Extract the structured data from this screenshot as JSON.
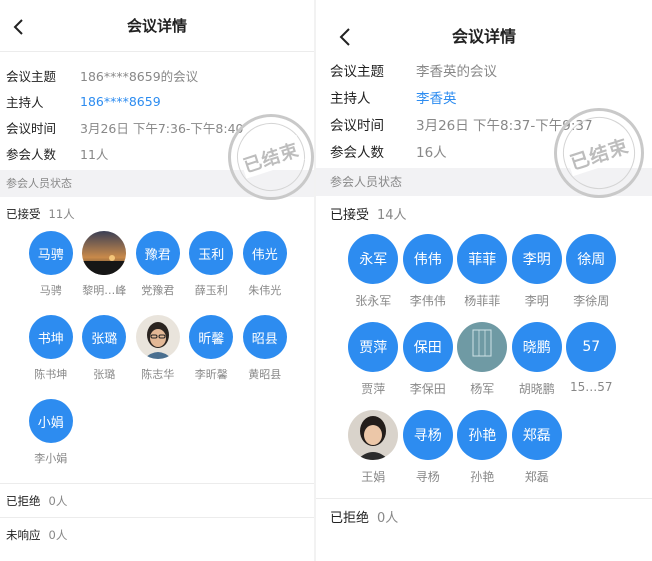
{
  "left": {
    "nav_title": "会议详情",
    "stamp_text": "已结束",
    "info": [
      {
        "label": "会议主题",
        "value": "186****8659的会议"
      },
      {
        "label": "主持人",
        "value": "186****8659"
      },
      {
        "label": "会议时间",
        "value": "3月26日 下午7:36-下午8:40"
      },
      {
        "label": "参会人数",
        "value": "11人"
      }
    ],
    "section_label": "参会人员状态",
    "accepted": {
      "label": "已接受",
      "count": "11人"
    },
    "participants": [
      {
        "avatar": "马骋",
        "name": "马骋"
      },
      {
        "avatar": "",
        "name": "黎明…峰"
      },
      {
        "avatar": "豫君",
        "name": "党豫君"
      },
      {
        "avatar": "玉利",
        "name": "薛玉利"
      },
      {
        "avatar": "伟光",
        "name": "朱伟光"
      },
      {
        "avatar": "书坤",
        "name": "陈书坤"
      },
      {
        "avatar": "张璐",
        "name": "张璐"
      },
      {
        "avatar": "",
        "name": "陈志华"
      },
      {
        "avatar": "昕馨",
        "name": "李昕馨"
      },
      {
        "avatar": "昭县",
        "name": "黄昭县"
      },
      {
        "avatar": "小娟",
        "name": "李小娟"
      }
    ],
    "rejected": {
      "label": "已拒绝",
      "count": "0人"
    },
    "no_response": {
      "label": "未响应",
      "count": "0人"
    }
  },
  "right": {
    "nav_title": "会议详情",
    "stamp_text": "已结束",
    "info": [
      {
        "label": "会议主题",
        "value": "李香英的会议"
      },
      {
        "label": "主持人",
        "value": "李香英"
      },
      {
        "label": "会议时间",
        "value": "3月26日 下午8:37-下午9:37"
      },
      {
        "label": "参会人数",
        "value": "16人"
      }
    ],
    "section_label": "参会人员状态",
    "accepted": {
      "label": "已接受",
      "count": "14人"
    },
    "participants": [
      {
        "avatar": "永军",
        "name": "张永军"
      },
      {
        "avatar": "伟伟",
        "name": "李伟伟"
      },
      {
        "avatar": "菲菲",
        "name": "杨菲菲"
      },
      {
        "avatar": "李明",
        "name": "李明"
      },
      {
        "avatar": "徐周",
        "name": "李徐周"
      },
      {
        "avatar": "贾萍",
        "name": "贾萍"
      },
      {
        "avatar": "保田",
        "name": "李保田"
      },
      {
        "avatar": "",
        "name": "杨军"
      },
      {
        "avatar": "晓鹏",
        "name": "胡晓鹏"
      },
      {
        "avatar": "57",
        "name": "15…57"
      },
      {
        "avatar": "",
        "name": "王娟"
      },
      {
        "avatar": "寻杨",
        "name": "寻杨"
      },
      {
        "avatar": "孙艳",
        "name": "孙艳"
      },
      {
        "avatar": "郑磊",
        "name": "郑磊"
      }
    ],
    "rejected": {
      "label": "已拒绝",
      "count": "0人"
    }
  },
  "colors": {
    "accent": "#2d8cf0",
    "section_bg": "#f2f2f4",
    "muted_text": "#888888",
    "stamp": "#c9c9c9"
  }
}
